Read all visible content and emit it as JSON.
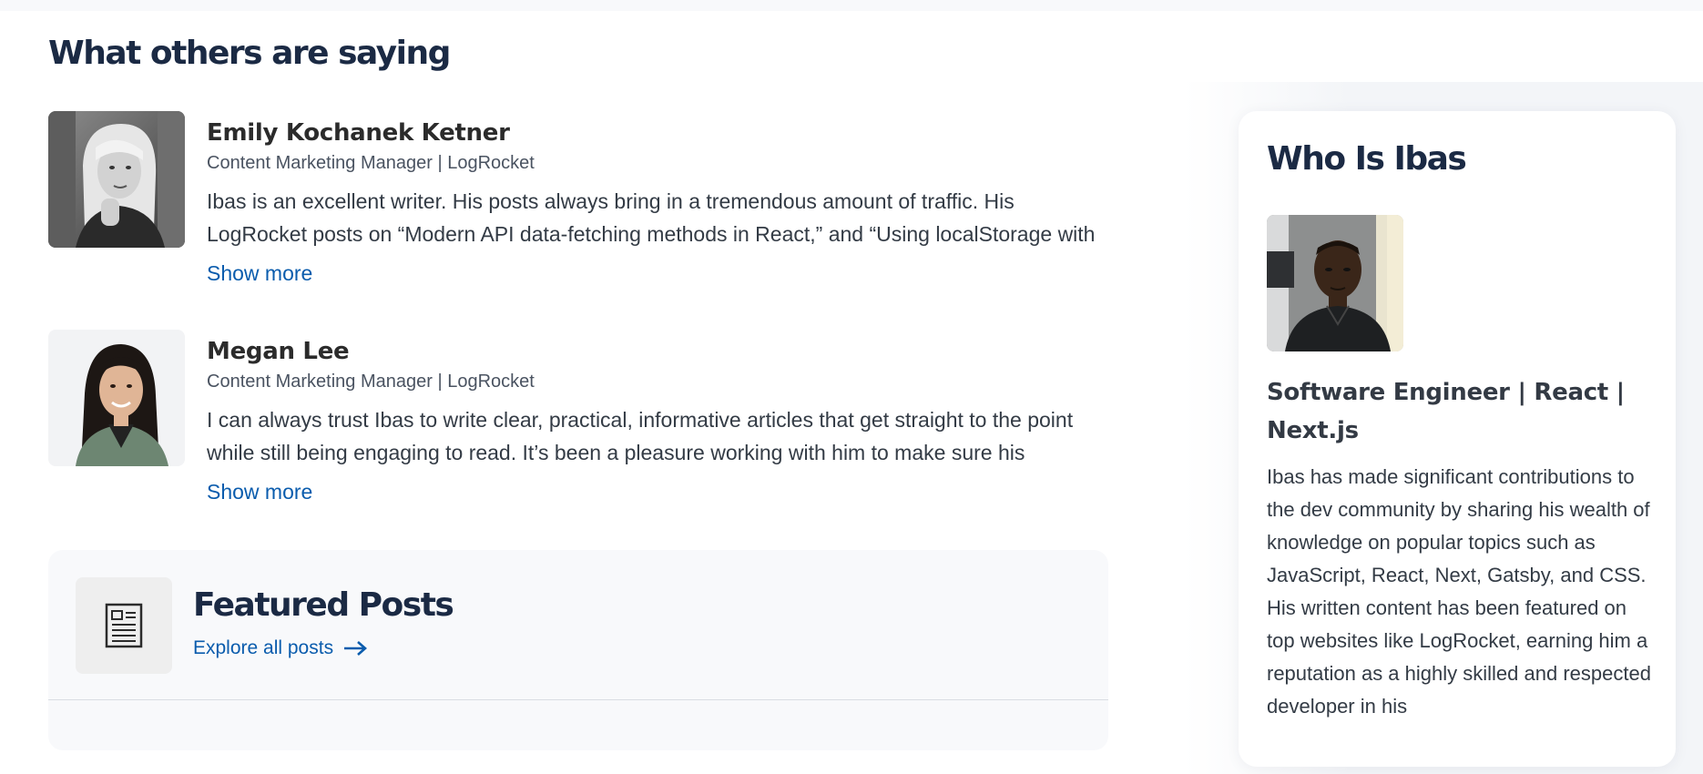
{
  "section": {
    "title": "What others are saying"
  },
  "testimonials": [
    {
      "name": "Emily Kochanek Ketner",
      "role": "Content Marketing Manager | LogRocket",
      "quote": "Ibas is an excellent writer. His posts always bring in a tremendous amount of traffic. His LogRocket posts on “Modern API data-fetching methods in React,” and “Using localStorage with",
      "show_more": "Show more"
    },
    {
      "name": "Megan Lee",
      "role": "Content Marketing Manager | LogRocket",
      "quote": "I can always trust Ibas to write clear, practical, informative articles that get straight to the point while still being engaging to read. It’s been a pleasure working with him to make sure his",
      "show_more": "Show more"
    }
  ],
  "featured": {
    "title": "Featured Posts",
    "link_label": "Explore all posts",
    "icon": "document-icon"
  },
  "who": {
    "title": "Who Is Ibas",
    "role": "Software Engineer | React | Next.js",
    "bio": "Ibas has made significant contributions to the dev community by sharing his wealth of knowledge on popular topics such as JavaScript, React, Next, Gatsby, and CSS. His written content has been featured on top websites like LogRocket, earning him a reputation as a highly skilled and respected developer in his"
  },
  "colors": {
    "link": "#0a5cad",
    "heading": "#1b2a44",
    "panel_bg": "#f8f9fb"
  }
}
